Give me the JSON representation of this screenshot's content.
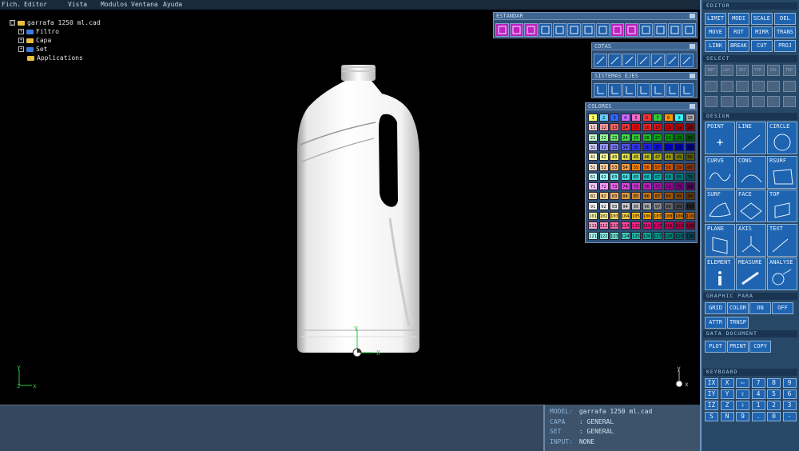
{
  "menu": [
    "Fich.",
    "Editor",
    "Vista",
    "Modulos",
    "Ventana",
    "Ayuda"
  ],
  "tree": {
    "root": "garrafa 1250 ml.cad",
    "children": [
      "Filtro",
      "Capa",
      "Set",
      "Applications"
    ],
    "root_toggle": "□",
    "child_toggle": "+"
  },
  "axes": {
    "x": "X",
    "y": "Y",
    "z": "Z",
    "x_lower": "x",
    "y_lower": "y"
  },
  "toolbars": {
    "estandar": "ESTANDAR",
    "cotas": "COTAS",
    "sistemas_ejes": "SISTEMAS EJES",
    "colores": "COLORES"
  },
  "colors": {
    "accent": "#1e64b0",
    "panel": "#274866",
    "highlight": "#c020c0"
  },
  "palette_rows": [
    [
      "1",
      "2",
      "3",
      "4",
      "5",
      "6",
      "7",
      "8",
      "9",
      "10"
    ],
    [
      "11",
      "12",
      "13",
      "14",
      "15",
      "16",
      "17",
      "18",
      "19",
      "20"
    ],
    [
      "21",
      "22",
      "23",
      "24",
      "25",
      "26",
      "27",
      "28",
      "29",
      "30"
    ],
    [
      "31",
      "32",
      "33",
      "34",
      "35",
      "36",
      "37",
      "38",
      "39",
      "40"
    ],
    [
      "41",
      "42",
      "43",
      "44",
      "45",
      "46",
      "47",
      "48",
      "49",
      "50"
    ],
    [
      "51",
      "52",
      "53",
      "54",
      "55",
      "56",
      "57",
      "58",
      "59",
      "60"
    ],
    [
      "61",
      "62",
      "63",
      "64",
      "65",
      "66",
      "67",
      "68",
      "69",
      "70"
    ],
    [
      "71",
      "72",
      "73",
      "74",
      "75",
      "76",
      "77",
      "78",
      "79",
      "80"
    ],
    [
      "81",
      "82",
      "83",
      "84",
      "85",
      "86",
      "87",
      "88",
      "89",
      "90"
    ],
    [
      "91",
      "92",
      "93",
      "94",
      "95",
      "96",
      "97",
      "98",
      "99",
      "100"
    ],
    [
      "101",
      "102",
      "103",
      "104",
      "105",
      "106",
      "107",
      "108",
      "109",
      "110"
    ],
    [
      "111",
      "112",
      "113",
      "114",
      "115",
      "116",
      "117",
      "118",
      "119",
      "120"
    ],
    [
      "121",
      "122",
      "123",
      "124",
      "125",
      "126",
      "127",
      "128",
      "129",
      "130"
    ]
  ],
  "palette_colors": [
    [
      "#ffff66",
      "#66ccff",
      "#3366ff",
      "#cc66ff",
      "#ff66cc",
      "#ff3333",
      "#33cc33",
      "#ff9900",
      "#33ffff",
      "#aaaaaa"
    ],
    [
      "#ffcccc",
      "#ff9999",
      "#ff6666",
      "#ff3333",
      "#ff0000",
      "#ee2222",
      "#dd1111",
      "#cc0000",
      "#aa0000",
      "#880000"
    ],
    [
      "#ccffcc",
      "#99ff99",
      "#66ee66",
      "#44dd44",
      "#33cc33",
      "#22bb22",
      "#11aa11",
      "#009900",
      "#007700",
      "#005500"
    ],
    [
      "#ccccff",
      "#9999ff",
      "#7777ff",
      "#5555ff",
      "#3333ff",
      "#2222ee",
      "#1111dd",
      "#0000cc",
      "#0000aa",
      "#000088"
    ],
    [
      "#ffffcc",
      "#ffff99",
      "#eeee66",
      "#dddd44",
      "#cccc33",
      "#bbbb22",
      "#aaaa11",
      "#999900",
      "#777700",
      "#555500"
    ],
    [
      "#ffe6cc",
      "#ffcc99",
      "#ffb366",
      "#ff9933",
      "#ff8000",
      "#ee7000",
      "#dd6000",
      "#cc5500",
      "#aa4400",
      "#883300"
    ],
    [
      "#ccffff",
      "#99ffff",
      "#66eeee",
      "#44dddd",
      "#33cccc",
      "#22bbbb",
      "#11aaaa",
      "#009999",
      "#007777",
      "#005555"
    ],
    [
      "#ffccff",
      "#ff99ff",
      "#ee66ee",
      "#dd44dd",
      "#cc33cc",
      "#bb22bb",
      "#aa11aa",
      "#990099",
      "#770077",
      "#550055"
    ],
    [
      "#ffe0b0",
      "#ffcc80",
      "#f0b060",
      "#e09a40",
      "#d08830",
      "#c07820",
      "#b06810",
      "#a05800",
      "#804600",
      "#603400"
    ],
    [
      "#ffffff",
      "#eeeeee",
      "#dddddd",
      "#cccccc",
      "#bbbbbb",
      "#aaaaaa",
      "#888888",
      "#666666",
      "#444444",
      "#222222"
    ],
    [
      "#ffffaa",
      "#ffee88",
      "#ffdd66",
      "#ffcc44",
      "#ffbb22",
      "#ffaa00",
      "#ee9900",
      "#dd8800",
      "#cc7700",
      "#bb6600"
    ],
    [
      "#ffaacc",
      "#ff88bb",
      "#ff66aa",
      "#ff4499",
      "#ff2288",
      "#ee1177",
      "#dd0066",
      "#cc0055",
      "#aa0044",
      "#880033"
    ],
    [
      "#aaffee",
      "#88eedd",
      "#66ddcc",
      "#44ccbb",
      "#22bbaa",
      "#11aa99",
      "#009988",
      "#008877",
      "#006666",
      "#004455"
    ]
  ],
  "right_panel": {
    "editor": {
      "title": "EDITOR",
      "buttons": [
        "LIMIT",
        "MODI",
        "SCALE",
        "DEL",
        "MOVE",
        "ROT",
        "MIRR",
        "TRANS",
        "LINK",
        "BREAK",
        "CUT",
        "PROJ"
      ]
    },
    "select": {
      "title": "SELECT",
      "buttons": [
        "ENT",
        "LAY",
        "SET",
        "TYP",
        "COL",
        "TRP"
      ]
    },
    "design": {
      "title": "DESIGN",
      "buttons": [
        "POINT",
        "LINE",
        "CIRCLE",
        "CURVE",
        "CONS",
        "RSURF",
        "SURF",
        "FACE",
        "TOP",
        "PLANE",
        "AXIS",
        "TEXT",
        "ELEMENT",
        "MEASURE",
        "ANALYSE"
      ]
    },
    "graphic": {
      "title": "GRAPHIC PARA",
      "buttons": [
        "GRID",
        "COLOR",
        "ON",
        "OFF",
        "ATTR",
        "TRNSP"
      ]
    },
    "data": {
      "title": "DATA DOCUMENT",
      "buttons": [
        "PLOT",
        "PRINT",
        "COPY"
      ]
    },
    "keyboard": {
      "title": "KEYBOARD",
      "keys": [
        "IX",
        "X",
        "⇦",
        "7",
        "8",
        "9",
        "IY",
        "Y",
        "⇧",
        "4",
        "5",
        "6",
        "IZ",
        "Z",
        "⇩",
        "1",
        "2",
        "3",
        "S",
        "N",
        "9",
        ".",
        "0",
        "-"
      ]
    }
  },
  "info": {
    "model_label": "MODEL:",
    "model": "garrafa 1250 ml.cad",
    "capa_label": "CAPA",
    "capa": ": GENERAL",
    "set_label": "SET",
    "set": ": GENERAL",
    "input_label": "INPUT:",
    "input": "NONE"
  }
}
